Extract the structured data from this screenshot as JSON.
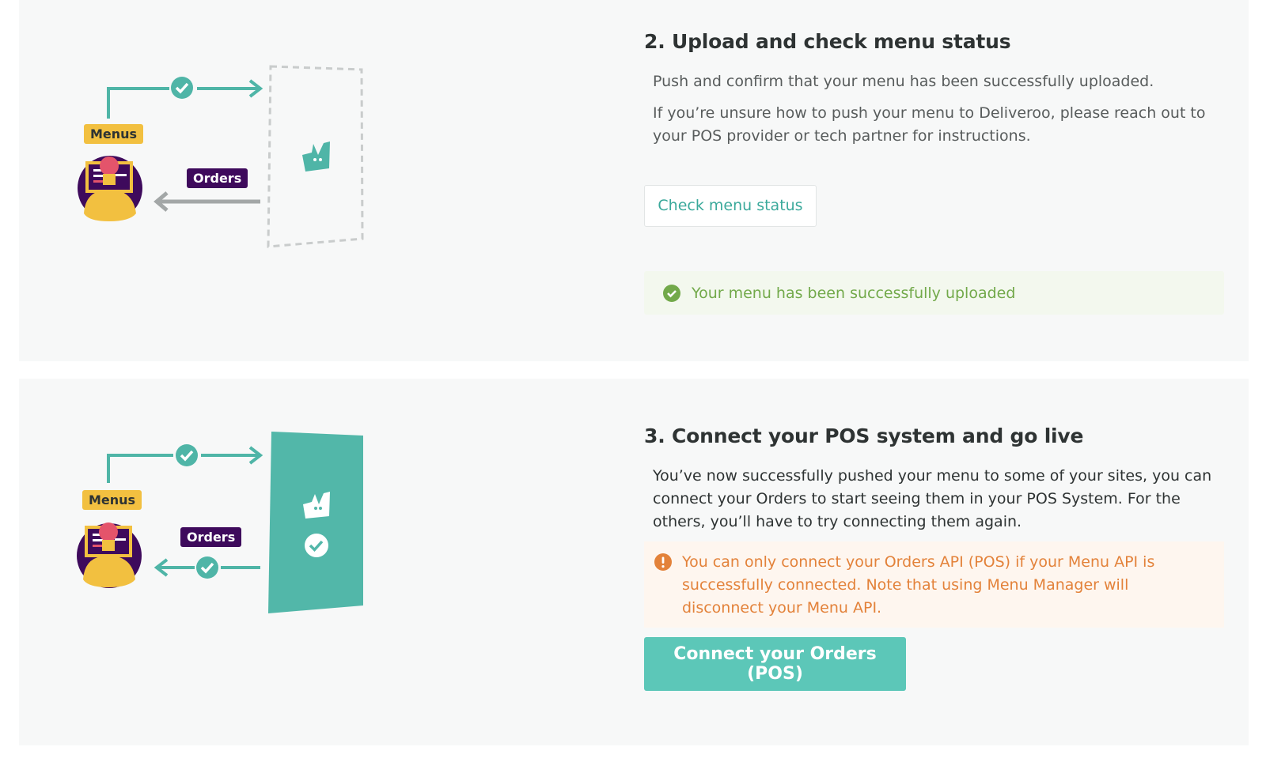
{
  "steps": [
    {
      "title": "2. Upload and check menu status",
      "paragraphs": [
        "Push and confirm that your menu has been successfully uploaded.",
        "If you’re unsure how to push your menu to Deliveroo, please reach out to your POS provider or tech partner for instructions."
      ],
      "button_label": "Check menu status",
      "status_message": "Your menu has been successfully uploaded"
    },
    {
      "title": "3. Connect your POS system and go live",
      "paragraphs": [
        "You’ve now successfully pushed your menu to some of your sites, you can connect your Orders to start seeing them in your POS System. For the others, you’ll have to try connecting them again."
      ],
      "warning_message": "You can only connect your Orders API (POS) if your Menu API is successfully connected. Note that using Menu Manager will disconnect your Menu API.",
      "button_label": "Connect your Orders (POS)"
    }
  ],
  "illustration": {
    "menus_label": "Menus",
    "orders_label": "Orders"
  },
  "colors": {
    "teal": "#5cc7b8",
    "teal_dark": "#3aa99b",
    "success_green": "#72a94a",
    "warning_orange": "#e3823a",
    "menus_yellow": "#f2c040",
    "orders_purple": "#3e0a5c"
  },
  "icons": {
    "check": "check-circle-icon",
    "warning": "exclamation-circle-icon",
    "deliveroo": "deliveroo-logo-icon"
  }
}
